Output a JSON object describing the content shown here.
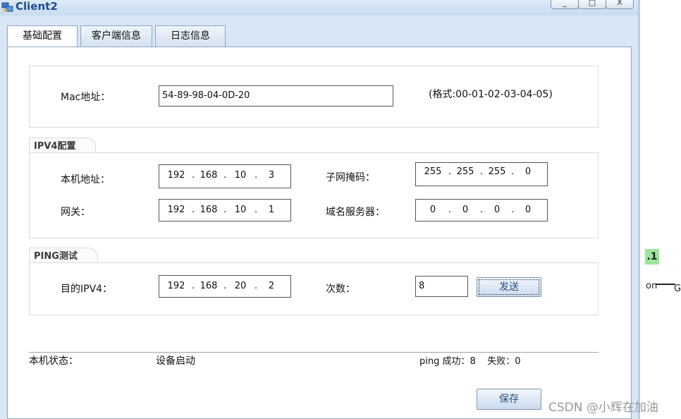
{
  "window": {
    "title": "Client2",
    "controls": {
      "minimize": "_",
      "maximize": "□",
      "close": "X"
    }
  },
  "tabs": [
    {
      "label": "基础配置",
      "active": true
    },
    {
      "label": "客户端信息",
      "active": false
    },
    {
      "label": "日志信息",
      "active": false
    }
  ],
  "mac": {
    "label": "Mac地址：",
    "value": "54-89-98-04-0D-20",
    "format_hint": "(格式:00-01-02-03-04-05)"
  },
  "ipv4": {
    "group_title": "IPV4配置",
    "local_label": "本机地址：",
    "local": [
      "192",
      "168",
      "10",
      "3"
    ],
    "mask_label": "子网掩码：",
    "mask": [
      "255",
      "255",
      "255",
      "0"
    ],
    "gateway_label": "网关：",
    "gateway": [
      "192",
      "168",
      "10",
      "1"
    ],
    "dns_label": "域名服务器：",
    "dns": [
      "0",
      "0",
      "0",
      "0"
    ]
  },
  "ping": {
    "group_title": "PING测试",
    "dest_label": "目的IPV4：",
    "dest": [
      "192",
      "168",
      "20",
      "2"
    ],
    "count_label": "次数：",
    "count": "8",
    "send_button": "发送"
  },
  "status": {
    "label": "本机状态：",
    "value": "设备启动",
    "ping_result": "ping 成功：8    失败：0"
  },
  "save_button": "保存",
  "background": {
    "badge": ".1",
    "text_on": "on",
    "text_g": "G"
  },
  "watermark": "CSDN @小辉在加油",
  "colors": {
    "title": "#1f4e8c",
    "chrome": "#d8e6f5",
    "badge": "#9be59b"
  }
}
